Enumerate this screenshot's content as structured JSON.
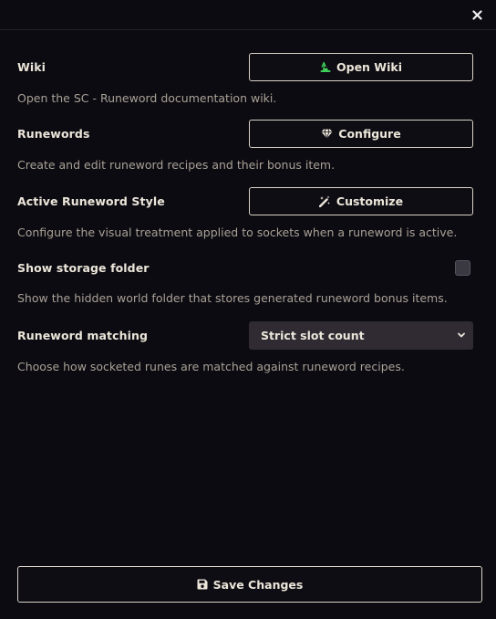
{
  "window": {
    "close_icon": "close-icon"
  },
  "settings": [
    {
      "label": "Wiki",
      "hint": "Open the SC - Runeword documentation wiki.",
      "button_label": "Open Wiki",
      "button_icon": "wizard-hat-icon",
      "icon_color": "#3fcf5a"
    },
    {
      "label": "Runewords",
      "hint": "Create and edit runeword recipes and their bonus item.",
      "button_label": "Configure",
      "button_icon": "gem-icon"
    },
    {
      "label": "Active Runeword Style",
      "hint": "Configure the visual treatment applied to sockets when a runeword is active.",
      "button_label": "Customize",
      "button_icon": "magic-wand-icon"
    },
    {
      "label": "Show storage folder",
      "hint": "Show the hidden world folder that stores generated runeword bonus items.",
      "checked": false
    },
    {
      "label": "Runeword matching",
      "hint": "Choose how socketed runes are matched against runeword recipes.",
      "selected_value": "Strict slot count"
    }
  ],
  "footer": {
    "save_label": "Save Changes",
    "save_icon": "floppy-disk-icon"
  },
  "colors": {
    "background": "#0c0b11",
    "text": "#ece6da",
    "hint": "#a8a196",
    "border": "#d8d2c6",
    "select_bg": "#302b33"
  }
}
